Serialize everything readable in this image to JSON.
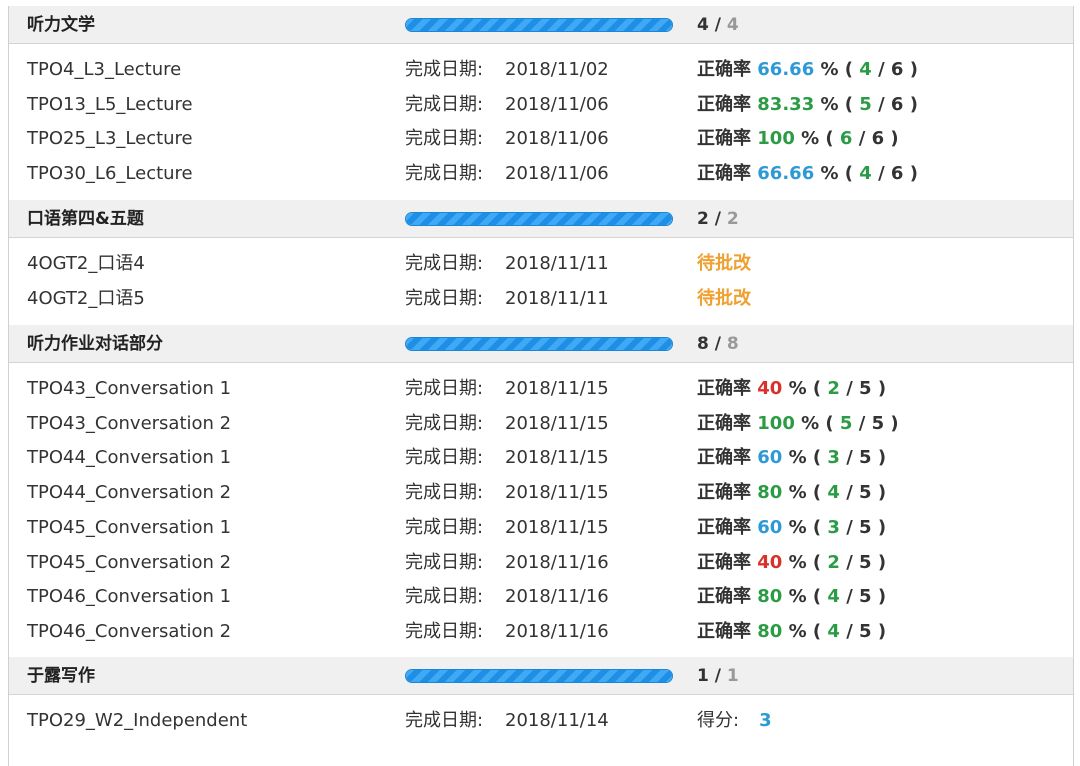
{
  "date_label": "完成日期:",
  "accuracy_label": "正确率",
  "sections": [
    {
      "title": "听力文学",
      "progress": 1.0,
      "done": "4",
      "total": "4",
      "rows": [
        {
          "name": "TPO4_L3_Lecture",
          "date": "2018/11/02",
          "pct": "66.66",
          "pct_color": "blue",
          "correct": "4",
          "count": "6"
        },
        {
          "name": "TPO13_L5_Lecture",
          "date": "2018/11/06",
          "pct": "83.33",
          "pct_color": "green",
          "correct": "5",
          "count": "6"
        },
        {
          "name": "TPO25_L3_Lecture",
          "date": "2018/11/06",
          "pct": "100",
          "pct_color": "green",
          "correct": "6",
          "count": "6"
        },
        {
          "name": "TPO30_L6_Lecture",
          "date": "2018/11/06",
          "pct": "66.66",
          "pct_color": "blue",
          "correct": "4",
          "count": "6"
        }
      ]
    },
    {
      "title": "口语第四&五题",
      "progress": 1.0,
      "done": "2",
      "total": "2",
      "rows": [
        {
          "name": "4OGT2_口语4",
          "date": "2018/11/11",
          "status": "待批改"
        },
        {
          "name": "4OGT2_口语5",
          "date": "2018/11/11",
          "status": "待批改"
        }
      ]
    },
    {
      "title": "听力作业对话部分",
      "progress": 1.0,
      "done": "8",
      "total": "8",
      "rows": [
        {
          "name": "TPO43_Conversation 1",
          "date": "2018/11/15",
          "pct": "40",
          "pct_color": "red",
          "correct": "2",
          "count": "5"
        },
        {
          "name": "TPO43_Conversation 2",
          "date": "2018/11/15",
          "pct": "100",
          "pct_color": "green",
          "correct": "5",
          "count": "5"
        },
        {
          "name": "TPO44_Conversation 1",
          "date": "2018/11/15",
          "pct": "60",
          "pct_color": "blue",
          "correct": "3",
          "count": "5"
        },
        {
          "name": "TPO44_Conversation 2",
          "date": "2018/11/15",
          "pct": "80",
          "pct_color": "green",
          "correct": "4",
          "count": "5"
        },
        {
          "name": "TPO45_Conversation 1",
          "date": "2018/11/15",
          "pct": "60",
          "pct_color": "blue",
          "correct": "3",
          "count": "5"
        },
        {
          "name": "TPO45_Conversation 2",
          "date": "2018/11/16",
          "pct": "40",
          "pct_color": "red",
          "correct": "2",
          "count": "5"
        },
        {
          "name": "TPO46_Conversation 1",
          "date": "2018/11/16",
          "pct": "80",
          "pct_color": "green",
          "correct": "4",
          "count": "5"
        },
        {
          "name": "TPO46_Conversation 2",
          "date": "2018/11/16",
          "pct": "80",
          "pct_color": "green",
          "correct": "4",
          "count": "5"
        }
      ]
    },
    {
      "title": "于露写作",
      "progress": 1.0,
      "done": "1",
      "total": "1",
      "rows": [
        {
          "name": "TPO29_W2_Independent",
          "date": "2018/11/14",
          "score_label": "得分:",
          "score": "3"
        }
      ]
    }
  ],
  "colors": {
    "blue": "#2d9ad6",
    "green": "#2b9c45",
    "red": "#d9312b",
    "pending": "#f0a030",
    "progress": "#3fa9f5"
  }
}
